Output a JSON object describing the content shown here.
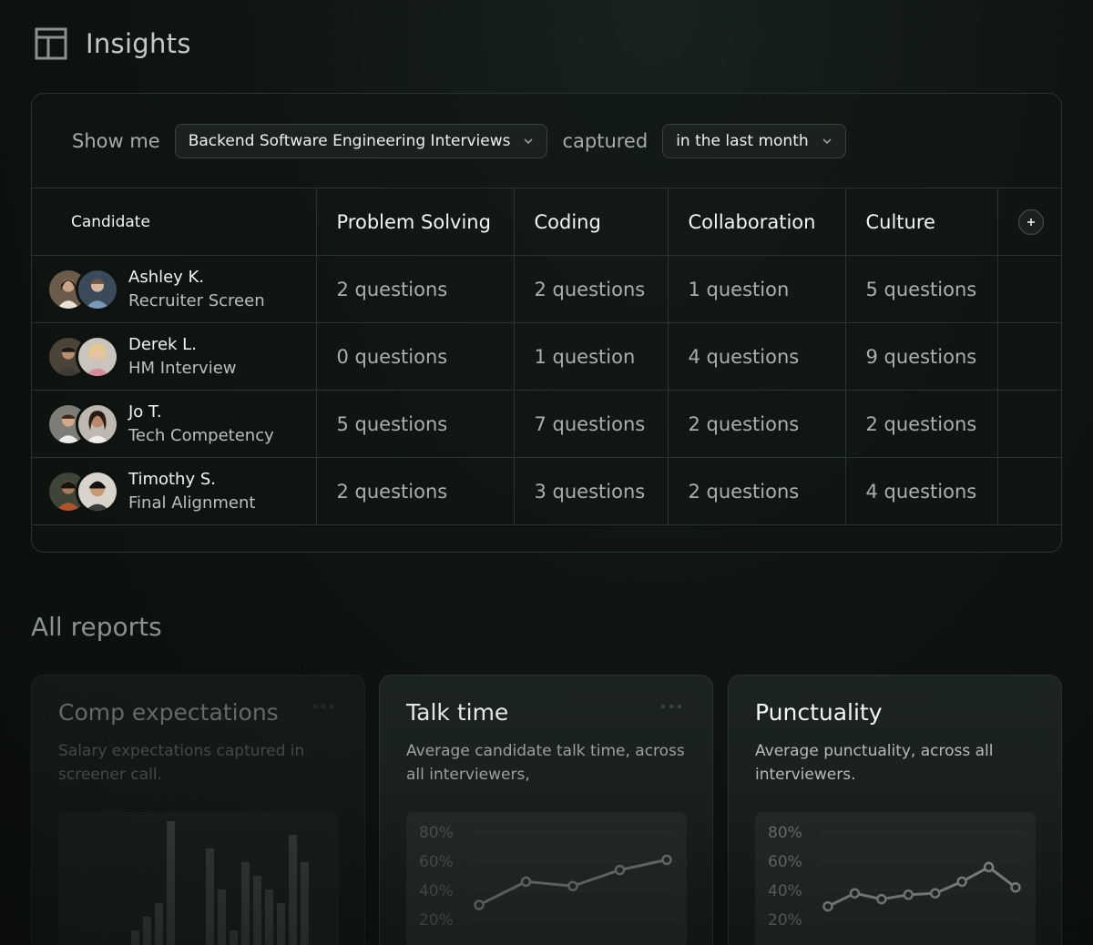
{
  "page": {
    "title": "Insights",
    "icon": "layout-icon"
  },
  "filters": {
    "show_me_label": "Show me",
    "interview_type": "Backend Software Engineering Interviews",
    "captured_label": "captured",
    "time_range": "in the last month"
  },
  "table": {
    "headers": [
      "Candidate",
      "Problem Solving",
      "Coding",
      "Collaboration",
      "Culture"
    ],
    "add_column_icon": "plus-icon",
    "rows": [
      {
        "name": "Ashley K.",
        "stage": "Recruiter Screen",
        "cells": [
          "2 questions",
          "2 questions",
          "1 question",
          "5 questions"
        ]
      },
      {
        "name": "Derek L.",
        "stage": "HM Interview",
        "cells": [
          "0 questions",
          "1 question",
          "4 questions",
          "9 questions"
        ]
      },
      {
        "name": "Jo T.",
        "stage": "Tech Competency",
        "cells": [
          "5 questions",
          "7 questions",
          "2 questions",
          "2 questions"
        ]
      },
      {
        "name": "Timothy S.",
        "stage": "Final Alignment",
        "cells": [
          "2 questions",
          "3 questions",
          "2 questions",
          "4 questions"
        ]
      }
    ]
  },
  "reports": {
    "title": "All reports",
    "cards": [
      {
        "title": "Comp expectations",
        "description": "Salary expectations captured in screener call."
      },
      {
        "title": "Talk time",
        "description": "Average candidate talk time, across all interviewers,"
      },
      {
        "title": "Punctuality",
        "description": "Average punctuality, across all interviewers."
      }
    ]
  },
  "chart_data": [
    {
      "type": "bar",
      "title": "Comp expectations",
      "values": [
        2,
        3,
        4,
        10,
        8,
        5,
        2,
        7,
        6,
        5,
        4,
        9,
        7
      ]
    },
    {
      "type": "line",
      "title": "Talk time",
      "y_ticks": [
        "80%",
        "60%",
        "40%",
        "20%"
      ],
      "ylim": [
        20,
        80
      ],
      "values": [
        30,
        46,
        43,
        54,
        61
      ]
    },
    {
      "type": "line",
      "title": "Punctuality",
      "y_ticks": [
        "80%",
        "60%",
        "40%",
        "20%"
      ],
      "ylim": [
        20,
        80
      ],
      "values": [
        29,
        38,
        34,
        37,
        38,
        46,
        56,
        42
      ]
    }
  ]
}
